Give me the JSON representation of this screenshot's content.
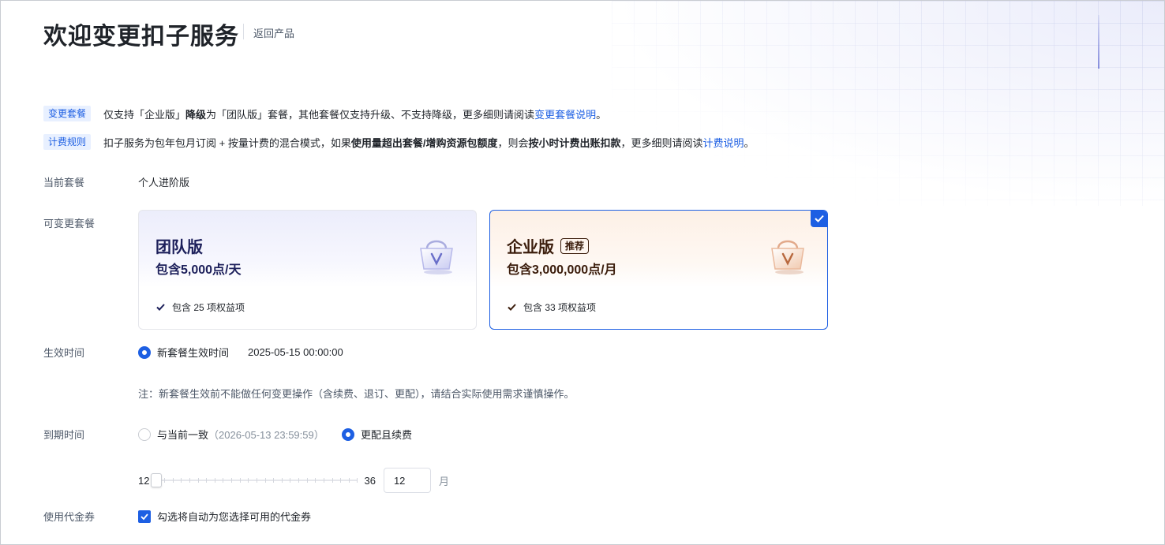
{
  "header": {
    "title": "欢迎变更扣子服务",
    "back_label": "返回产品"
  },
  "notices": [
    {
      "tag": "变更套餐",
      "t1": "仅支持「企业版」",
      "b1": "降级",
      "t2": "为「团队版」套餐，其他套餐仅支持升级、不支持降级，更多细则请阅读 ",
      "link": "变更套餐说明",
      "t3": "。"
    },
    {
      "tag": "计费规则",
      "t1": "扣子服务为包年包月订阅 + 按量计费的混合模式，如果",
      "b1": "使用量超出套餐/增购资源包额度",
      "t2": "，则会",
      "b2": "按小时计费出账扣款",
      "t3": "，更多细则请阅读 ",
      "link": "计费说明",
      "t4": "。"
    }
  ],
  "current_plan": {
    "label": "当前套餐",
    "value": "个人进阶版"
  },
  "plans": {
    "label": "可变更套餐",
    "items": [
      {
        "name": "团队版",
        "quota": "包含5,000点/天",
        "benefits": "包含 25 项权益项",
        "selected": false
      },
      {
        "name": "企业版",
        "badge": "推荐",
        "quota": "包含3,000,000点/月",
        "benefits": "包含 33 项权益项",
        "selected": true
      }
    ]
  },
  "effective": {
    "label": "生效时间",
    "option": "新套餐生效时间",
    "datetime": "2025-05-15 00:00:00",
    "note": "注：新套餐生效前不能做任何变更操作（含续费、退订、更配），请结合实际使用需求谨慎操作。"
  },
  "expiry": {
    "label": "到期时间",
    "option1": "与当前一致",
    "option1_date": "（2026-05-13 23:59:59）",
    "option2": "更配且续费",
    "selected": "option2",
    "slider": {
      "min": "12",
      "max": "36",
      "value": "12",
      "unit": "月"
    }
  },
  "voucher": {
    "label": "使用代金券",
    "checkbox_label": "勾选将自动为您选择可用的代金券",
    "checked": true
  },
  "colors": {
    "primary": "#1d5fe3",
    "team_text": "#1c1f5a",
    "enterprise_text": "#3b1d0c"
  }
}
